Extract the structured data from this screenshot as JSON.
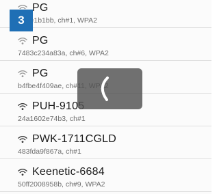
{
  "badge": {
    "label": "3"
  },
  "networks": [
    {
      "ssid": "PG",
      "detail": "829e1b1bb, ch#1, WPA2",
      "icon": "wifi-icon"
    },
    {
      "ssid": "PG",
      "detail": "7483c234a83a, ch#6, WPA2",
      "icon": "wifi-icon"
    },
    {
      "ssid": "PG",
      "detail": "b4fbe4f409ae, ch#11, WPA2",
      "icon": "wifi-icon"
    },
    {
      "ssid": "PUH-9105",
      "detail": "24a1602e74b3, ch#1",
      "icon": "wifi-icon"
    },
    {
      "ssid": "PWK-1711CGLD",
      "detail": "483fda9f867a, ch#1",
      "icon": "wifi-icon"
    },
    {
      "ssid": "Keenetic-6684",
      "detail": "50ff2008958b, ch#9, WPA2",
      "icon": "wifi-icon"
    }
  ],
  "loading_overlay": {
    "icon": "loading-spinner-icon"
  },
  "colors": {
    "badge": "#1f6fb5",
    "overlay": "#505050"
  }
}
